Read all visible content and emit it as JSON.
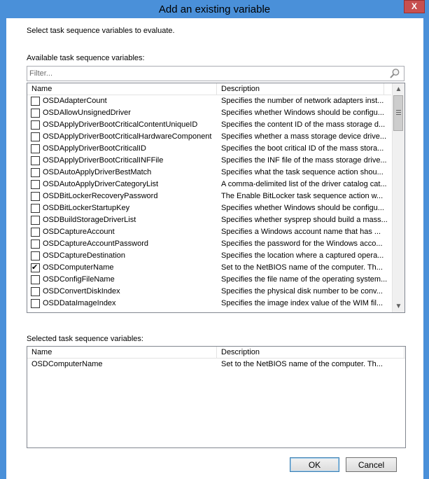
{
  "window": {
    "title": "Add an existing variable",
    "close_label": "X"
  },
  "intro_text": "Select task sequence variables to evaluate.",
  "available": {
    "label": "Available task sequence variables:",
    "filter_placeholder": "Filter...",
    "columns": {
      "name": "Name",
      "description": "Description"
    },
    "rows": [
      {
        "name": "OSDAdapterCount",
        "description": "Specifies the number of network adapters inst...",
        "checked": false
      },
      {
        "name": "OSDAllowUnsignedDriver",
        "description": "Specifies whether Windows should be configu...",
        "checked": false
      },
      {
        "name": "OSDApplyDriverBootCriticalContentUniqueID",
        "description": "Specifies the content ID of the mass storage d...",
        "checked": false
      },
      {
        "name": "OSDApplyDriverBootCriticalHardwareComponent",
        "description": "Specifies whether a mass storage device drive...",
        "checked": false
      },
      {
        "name": "OSDApplyDriverBootCriticalID",
        "description": "Specifies the boot critical ID of the mass stora...",
        "checked": false
      },
      {
        "name": "OSDApplyDriverBootCriticalINFFile",
        "description": "Specifies the INF file of the mass storage drive...",
        "checked": false
      },
      {
        "name": "OSDAutoApplyDriverBestMatch",
        "description": "Specifies what the task sequence action shou...",
        "checked": false
      },
      {
        "name": "OSDAutoApplyDriverCategoryList",
        "description": "A comma-delimited list of the driver catalog cat...",
        "checked": false
      },
      {
        "name": "OSDBitLockerRecoveryPassword",
        "description": "The Enable BitLocker task sequence action w...",
        "checked": false
      },
      {
        "name": "OSDBitLockerStartupKey",
        "description": "Specifies whether Windows should be configu...",
        "checked": false
      },
      {
        "name": "OSDBuildStorageDriverList",
        "description": "Specifies whether sysprep should build a mass...",
        "checked": false
      },
      {
        "name": "OSDCaptureAccount",
        "description": "Specifies a Windows account name that has ...",
        "checked": false
      },
      {
        "name": "OSDCaptureAccountPassword",
        "description": "Specifies the password for the Windows acco...",
        "checked": false
      },
      {
        "name": "OSDCaptureDestination",
        "description": "Specifies the location where a captured opera...",
        "checked": false
      },
      {
        "name": "OSDComputerName",
        "description": "Set to the NetBIOS name of the computer. Th...",
        "checked": true
      },
      {
        "name": "OSDConfigFileName",
        "description": "Specifies the file name of the operating system...",
        "checked": false
      },
      {
        "name": "OSDConvertDiskIndex",
        "description": "Specifies the physical disk number to be conv...",
        "checked": false
      },
      {
        "name": "OSDDataImageIndex",
        "description": "Specifies the image index value of the WIM fil...",
        "checked": false
      }
    ]
  },
  "selected": {
    "label": "Selected task sequence variables:",
    "columns": {
      "name": "Name",
      "description": "Description"
    },
    "rows": [
      {
        "name": "OSDComputerName",
        "description": "Set to the NetBIOS name of the computer. Th..."
      }
    ]
  },
  "buttons": {
    "ok": "OK",
    "cancel": "Cancel"
  }
}
